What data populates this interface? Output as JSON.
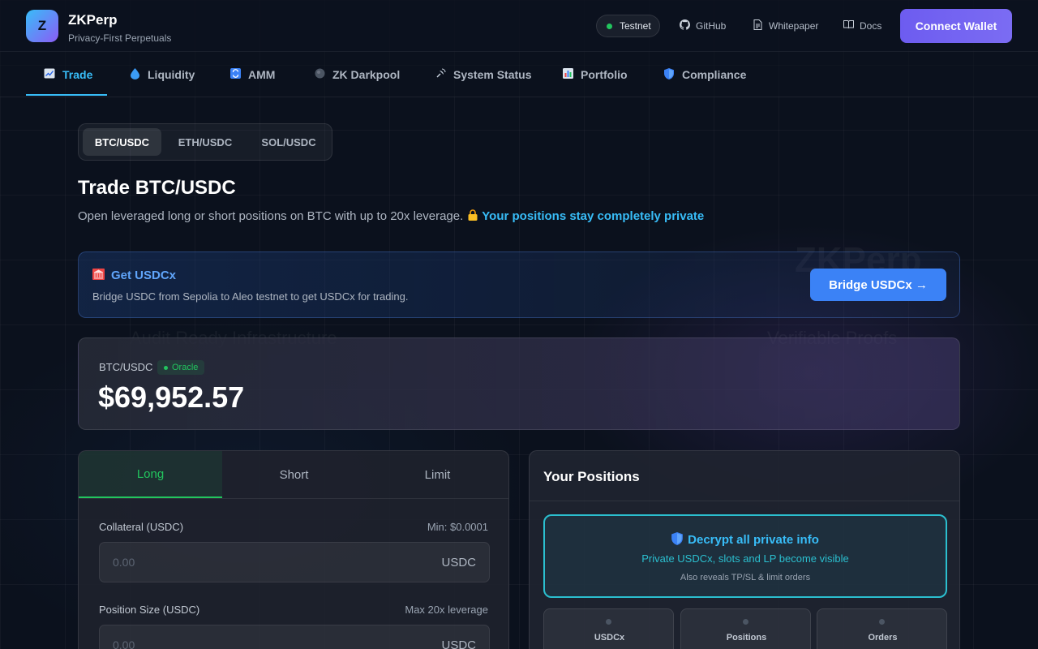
{
  "brand": {
    "name": "ZKPerp",
    "tagline": "Privacy-First Perpetuals",
    "logo_letter": "Z"
  },
  "header": {
    "network": "Testnet",
    "links": [
      {
        "label": "GitHub",
        "icon": "github-icon"
      },
      {
        "label": "Whitepaper",
        "icon": "document-icon"
      },
      {
        "label": "Docs",
        "icon": "book-icon"
      }
    ],
    "connect_label": "Connect Wallet"
  },
  "nav": {
    "items": [
      {
        "label": "Trade",
        "icon": "chart-icon",
        "active": true
      },
      {
        "label": "Liquidity",
        "icon": "droplet-icon"
      },
      {
        "label": "AMM",
        "icon": "swap-icon"
      },
      {
        "label": "ZK Darkpool",
        "icon": "dark-circle-icon"
      },
      {
        "label": "System Status",
        "icon": "satellite-icon"
      },
      {
        "label": "Portfolio",
        "icon": "bar-chart-icon"
      },
      {
        "label": "Compliance",
        "icon": "shield-icon"
      }
    ]
  },
  "markets": {
    "options": [
      "BTC/USDC",
      "ETH/USDC",
      "SOL/USDC"
    ],
    "selected": "BTC/USDC"
  },
  "page": {
    "title": "Trade BTC/USDC",
    "subtitle": "Open leveraged long or short positions on BTC with up to 20x leverage.",
    "privacy_note": "Your positions stay completely private"
  },
  "bridge": {
    "title": "Get USDCx",
    "description": "Bridge USDC from Sepolia to Aleo testnet to get USDCx for trading.",
    "button": "Bridge USDCx →"
  },
  "price": {
    "pair": "BTC/USDC",
    "source": "Oracle",
    "value": "$69,952.57"
  },
  "order": {
    "tabs": [
      "Long",
      "Short",
      "Limit"
    ],
    "active_tab": "Long",
    "collateral": {
      "label": "Collateral (USDC)",
      "hint": "Min: $0.0001",
      "placeholder": "0.00",
      "unit": "USDC"
    },
    "size": {
      "label": "Position Size (USDC)",
      "hint": "Max 20x leverage",
      "placeholder": "0.00",
      "unit": "USDC"
    }
  },
  "positions": {
    "title": "Your Positions",
    "decrypt": {
      "title": "Decrypt all private info",
      "subtitle": "Private USDCx, slots and LP become visible",
      "note": "Also reveals TP/SL & limit orders"
    },
    "stats": [
      "USDCx",
      "Positions",
      "Orders"
    ]
  },
  "colors": {
    "accent": "#38bdf8",
    "wallet": "#6d5cf0",
    "long": "#22c55e",
    "bridge": "#3b82f6"
  }
}
